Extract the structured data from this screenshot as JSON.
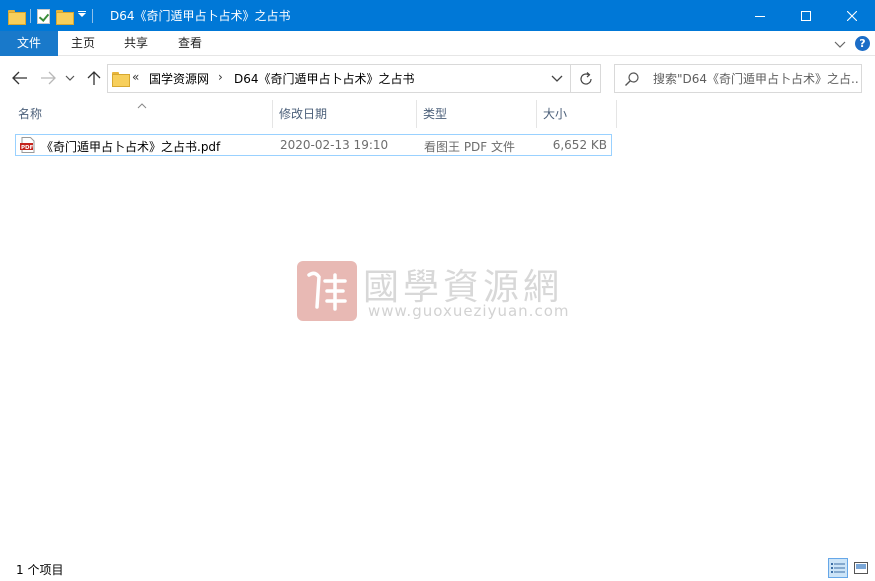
{
  "window": {
    "title": "D64《奇门遁甲占卜占术》之占书",
    "quick_access_icons": [
      "folder-icon",
      "properties-check-icon",
      "new-folder-icon",
      "customize-dropdown-icon"
    ],
    "controls": [
      "minimize-icon",
      "maximize-icon",
      "close-icon"
    ]
  },
  "ribbon": {
    "file_tab": "文件",
    "tabs": [
      "主页",
      "共享",
      "查看"
    ],
    "accent": "#1979ca"
  },
  "nav": {
    "more_label": "«",
    "breadcrumbs": [
      "国学资源网",
      "D64《奇门遁甲占卜占术》之占书"
    ],
    "separator": "›",
    "search_placeholder": "搜索\"D64《奇门遁甲占卜占术》之占..."
  },
  "columns": [
    "名称",
    "修改日期",
    "类型",
    "大小"
  ],
  "files": [
    {
      "name": "《奇门遁甲占卜占术》之占书.pdf",
      "modified": "2020-02-13 19:10",
      "type": "看图王 PDF 文件",
      "size": "6,652 KB",
      "icon": "pdf-file-icon"
    }
  ],
  "watermark": {
    "title": "國學資源網",
    "url": "www.guoxueziyuan.com"
  },
  "status": {
    "item_count": "1 个项目"
  },
  "colors": {
    "titlebar": "#0078d7",
    "selection_border": "#99d1ff",
    "header_text": "#4c607a"
  }
}
